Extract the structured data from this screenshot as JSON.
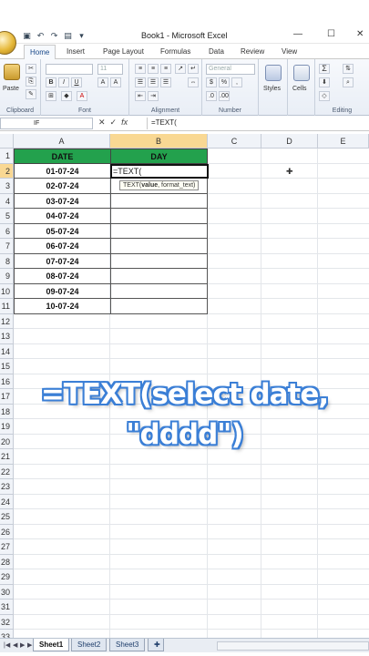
{
  "window": {
    "title": "Book1 - Microsoft Excel",
    "controls": [
      "—",
      "☐",
      "✕"
    ]
  },
  "quick_access": [
    "save-icon",
    "undo-icon",
    "redo-icon",
    "print-preview-icon",
    "customize-icon"
  ],
  "ribbon": {
    "tabs": [
      "Home",
      "Insert",
      "Page Layout",
      "Formulas",
      "Data",
      "Review",
      "View"
    ],
    "active_tab": "Home",
    "groups": {
      "clipboard": {
        "label": "Clipboard",
        "paste_label": "Paste"
      },
      "font": {
        "label": "Font",
        "font_name": "",
        "font_size": "11",
        "bold": "B",
        "italic": "I",
        "underline": "U"
      },
      "alignment": {
        "label": "Alignment"
      },
      "number": {
        "label": "Number",
        "format": "General",
        "currency": "$",
        "percent": "%",
        "comma": ","
      },
      "styles": {
        "label": "Styles"
      },
      "cells": {
        "label": "Cells"
      },
      "editing": {
        "label": "Editing",
        "sum": "Σ"
      }
    }
  },
  "formula_bar": {
    "name_box": "IF",
    "cancel": "✕",
    "enter": "✓",
    "fx": "fx",
    "formula": "=TEXT("
  },
  "grid": {
    "columns": [
      "A",
      "B",
      "C",
      "D",
      "E"
    ],
    "rows": [
      "1",
      "2",
      "3",
      "4",
      "5",
      "6",
      "7",
      "8",
      "9",
      "10",
      "11",
      "12",
      "13",
      "14",
      "15",
      "16",
      "17",
      "18",
      "19",
      "20",
      "21",
      "22",
      "23",
      "24",
      "25",
      "26",
      "27",
      "28",
      "29",
      "30",
      "31",
      "32",
      "33"
    ],
    "header_A": "DATE",
    "header_B": "DAY",
    "dates": [
      "01-07-24",
      "02-07-24",
      "03-07-24",
      "04-07-24",
      "05-07-24",
      "06-07-24",
      "07-07-24",
      "08-07-24",
      "09-07-24",
      "10-07-24"
    ],
    "active_cell_text": "=TEXT(",
    "tooltip": {
      "func": "TEXT(",
      "arg1": "value",
      "rest": ", format_text)"
    },
    "header_fill": "#23a14d"
  },
  "overlay": {
    "line1": "=TEXT(select date,",
    "line2": "\"dddd\")"
  },
  "sheets": {
    "tabs": [
      "Sheet1",
      "Sheet2",
      "Sheet3"
    ],
    "active": "Sheet1"
  }
}
